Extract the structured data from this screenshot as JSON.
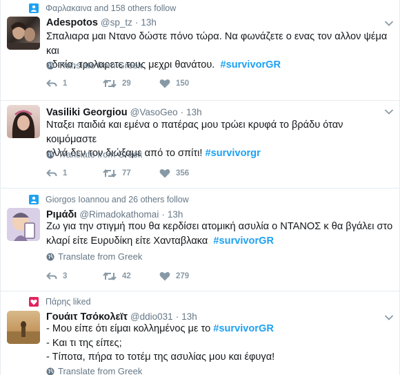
{
  "translate_label": "Translate from Greek",
  "colors": {
    "accent": "#1da1f2",
    "like": "#e0245e",
    "muted": "#657786",
    "action": "#8899a6"
  },
  "tweets": [
    {
      "context": "Φαρλακαινα and 158 others follow",
      "context_icon": "follow-person-icon",
      "name": "Adespotos",
      "handle": "@sp_tz",
      "time": "13h",
      "text_lines": [
        "Σπαλιαρα μαι Ντανο δώστε πόνο τώρα. Να φωνάζετε ο ενας τον αλλον ψέμα και",
        "αδικία, τρολαρετε τους μεχρι θανάτου."
      ],
      "hashtag": "#survivorGR",
      "replies": "1",
      "retweets": "29",
      "likes": "150"
    },
    {
      "name": "Vasiliki Georgiou",
      "handle": "@VasoGeo",
      "time": "13h",
      "text_lines": [
        "Νταξει παιδιά και εμένα ο πατέρας μου τρώει κρυφά το βράδυ όταν κοιμόμαστε",
        "αλλά δεν τον διώξαμε από το σπίτι!"
      ],
      "hashtag": "#survivorgr",
      "replies": "1",
      "retweets": "77",
      "likes": "356"
    },
    {
      "context": "Giorgos Ioannou and 26 others follow",
      "context_icon": "follow-person-icon",
      "name": "Ριμάδι",
      "handle": "@Rimadokathomai",
      "time": "13h",
      "text_lines": [
        "Ζω για την στιγμή που θα κερδίσει ατομική ασυλία ο ΝΤΑΝΟΣ κ θα βγάλει στο",
        "κλαρί είτε Ευρυδίκη είτε Χανταβλακα"
      ],
      "hashtag": "#survivorGR",
      "replies": "3",
      "retweets": "42",
      "likes": "279"
    },
    {
      "context": "Πάρης liked",
      "context_icon": "heart-icon",
      "name": "Γουάιτ Τσόκολεϊτ",
      "handle": "@ddio031",
      "time": "13h",
      "line1_prefix": "- Μου είπε ότι είμαι κολλημένος με το",
      "hashtag": "#survivorGR",
      "line2": "- Και τι της είπες;",
      "line3": "- Τίποτα, πήρα το τοτέμ της ασυλίας μου και έφυγα!"
    }
  ]
}
